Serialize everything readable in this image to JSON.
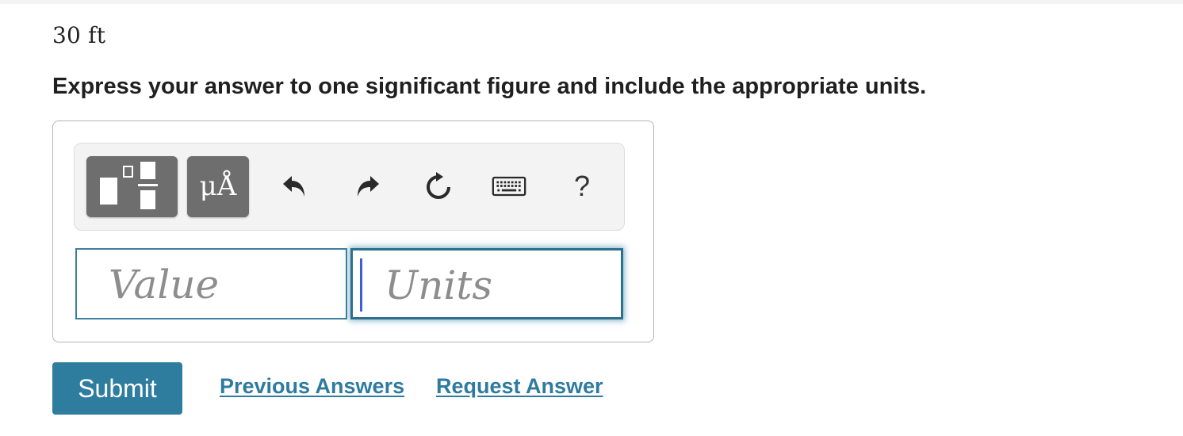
{
  "question": {
    "given_value": "30 ft",
    "instruction": "Express your answer to one significant figure and include the appropriate units."
  },
  "toolbar": {
    "templates_icon": "fraction-templates-icon",
    "units_label": "μÅ",
    "undo_icon": "undo-arrow-icon",
    "redo_icon": "redo-arrow-icon",
    "reset_icon": "reset-circular-arrow-icon",
    "keyboard_icon": "keyboard-icon",
    "help_label": "?"
  },
  "inputs": {
    "value": {
      "value": "",
      "placeholder": "Value"
    },
    "units": {
      "value": "",
      "placeholder": "Units"
    }
  },
  "actions": {
    "submit_label": "Submit",
    "previous_answers_label": "Previous Answers",
    "request_answer_label": "Request Answer"
  },
  "colors": {
    "accent": "#2e7c9e",
    "link": "#2f7ba0",
    "toolbar_button": "#6e6e6e",
    "focus_ring": "#2d6f8e"
  }
}
